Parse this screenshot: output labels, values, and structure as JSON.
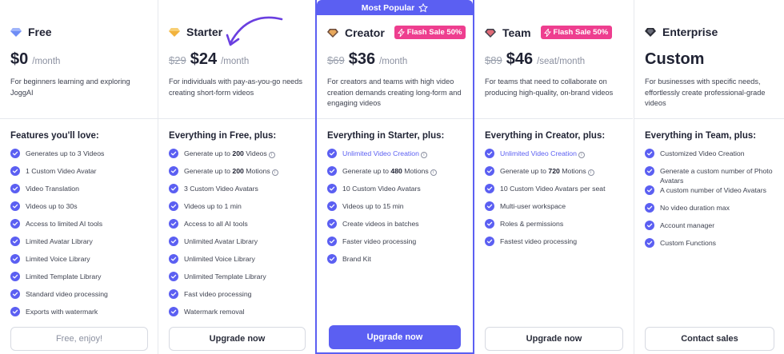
{
  "popular_label": "Most Popular",
  "colors": {
    "accent": "#5b5ff2",
    "flash": "#ee3e8f"
  },
  "plans": [
    {
      "name": "Free",
      "icon": "diamond-blue-icon",
      "price": "$0",
      "period": "/month",
      "description": "For beginners learning and exploring JoggAI",
      "features_title": "Features you'll love:",
      "features": [
        {
          "text": "Generates up to 3 Videos"
        },
        {
          "text": "1 Custom Video Avatar"
        },
        {
          "text": "Video Translation"
        },
        {
          "text": "Videos up to 30s"
        },
        {
          "text": "Access to limited AI tools"
        },
        {
          "text": "Limited Avatar Library"
        },
        {
          "text": "Limited Voice Library"
        },
        {
          "text": "Limited Template Library"
        },
        {
          "text": "Standard video processing"
        },
        {
          "text": "Exports with watermark"
        }
      ],
      "cta": "Free, enjoy!"
    },
    {
      "name": "Starter",
      "icon": "diamond-gold-icon",
      "old_price": "$29",
      "price": "$24",
      "period": "/month",
      "description": "For individuals with pay-as-you-go needs creating short-form videos",
      "features_title": "Everything in Free, plus:",
      "features": [
        {
          "pre": "Generate up to ",
          "bold": "200",
          "post": " Videos",
          "info": true
        },
        {
          "pre": "Generate up to ",
          "bold": "200",
          "post": " Motions",
          "info": true
        },
        {
          "text": "3 Custom Video Avatars"
        },
        {
          "text": "Videos up to 1 min"
        },
        {
          "text": "Access to all AI tools"
        },
        {
          "text": "Unlimited Avatar Library"
        },
        {
          "text": "Unlimited Voice Library"
        },
        {
          "text": "Unlimited Template Library"
        },
        {
          "text": "Fast video processing"
        },
        {
          "text": "Watermark removal"
        }
      ],
      "cta": "Upgrade now"
    },
    {
      "name": "Creator",
      "icon": "diamond-bronze-icon",
      "flash": "Flash Sale 50%",
      "old_price": "$69",
      "price": "$36",
      "period": "/month",
      "description": "For creators and teams with high video creation demands creating long-form and engaging videos",
      "features_title": "Everything in Starter, plus:",
      "features": [
        {
          "text": "Unlimited Video Creation",
          "link": true,
          "info": true
        },
        {
          "pre": "Generate up to ",
          "bold": "480",
          "post": " Motions",
          "info": true
        },
        {
          "text": "10 Custom Video Avatars"
        },
        {
          "text": "Videos up to 15 min"
        },
        {
          "text": "Create videos in batches"
        },
        {
          "text": "Faster video processing"
        },
        {
          "text": "Brand Kit"
        }
      ],
      "cta": "Upgrade now"
    },
    {
      "name": "Team",
      "icon": "diamond-dark-icon",
      "flash": "Flash Sale 50%",
      "old_price": "$89",
      "price": "$46",
      "period": "/seat/month",
      "description": "For teams that need to collaborate on producing high-quality, on-brand videos",
      "features_title": "Everything in Creator, plus:",
      "features": [
        {
          "text": "Unlimited Video Creation",
          "link": true,
          "info": true
        },
        {
          "pre": "Generate up to ",
          "bold": "720",
          "post": " Motions",
          "info": true
        },
        {
          "text": "10 Custom Video Avatars per seat"
        },
        {
          "text": "Multi-user workspace"
        },
        {
          "text": "Roles & permissions"
        },
        {
          "text": "Fastest video processing"
        }
      ],
      "cta": "Upgrade now"
    },
    {
      "name": "Enterprise",
      "icon": "diamond-black-icon",
      "price_text": "Custom",
      "description": "For businesses with specific needs, effortlessly create professional-grade videos",
      "features_title": "Everything in Team, plus:",
      "features": [
        {
          "text": "Customized Video Creation"
        },
        {
          "text": "Generate a custom number of Photo Avatars"
        },
        {
          "text": "A custom number of Video Avatars"
        },
        {
          "text": "No video duration max"
        },
        {
          "text": "Account manager"
        },
        {
          "text": "Custom Functions"
        }
      ],
      "cta": "Contact sales"
    }
  ]
}
